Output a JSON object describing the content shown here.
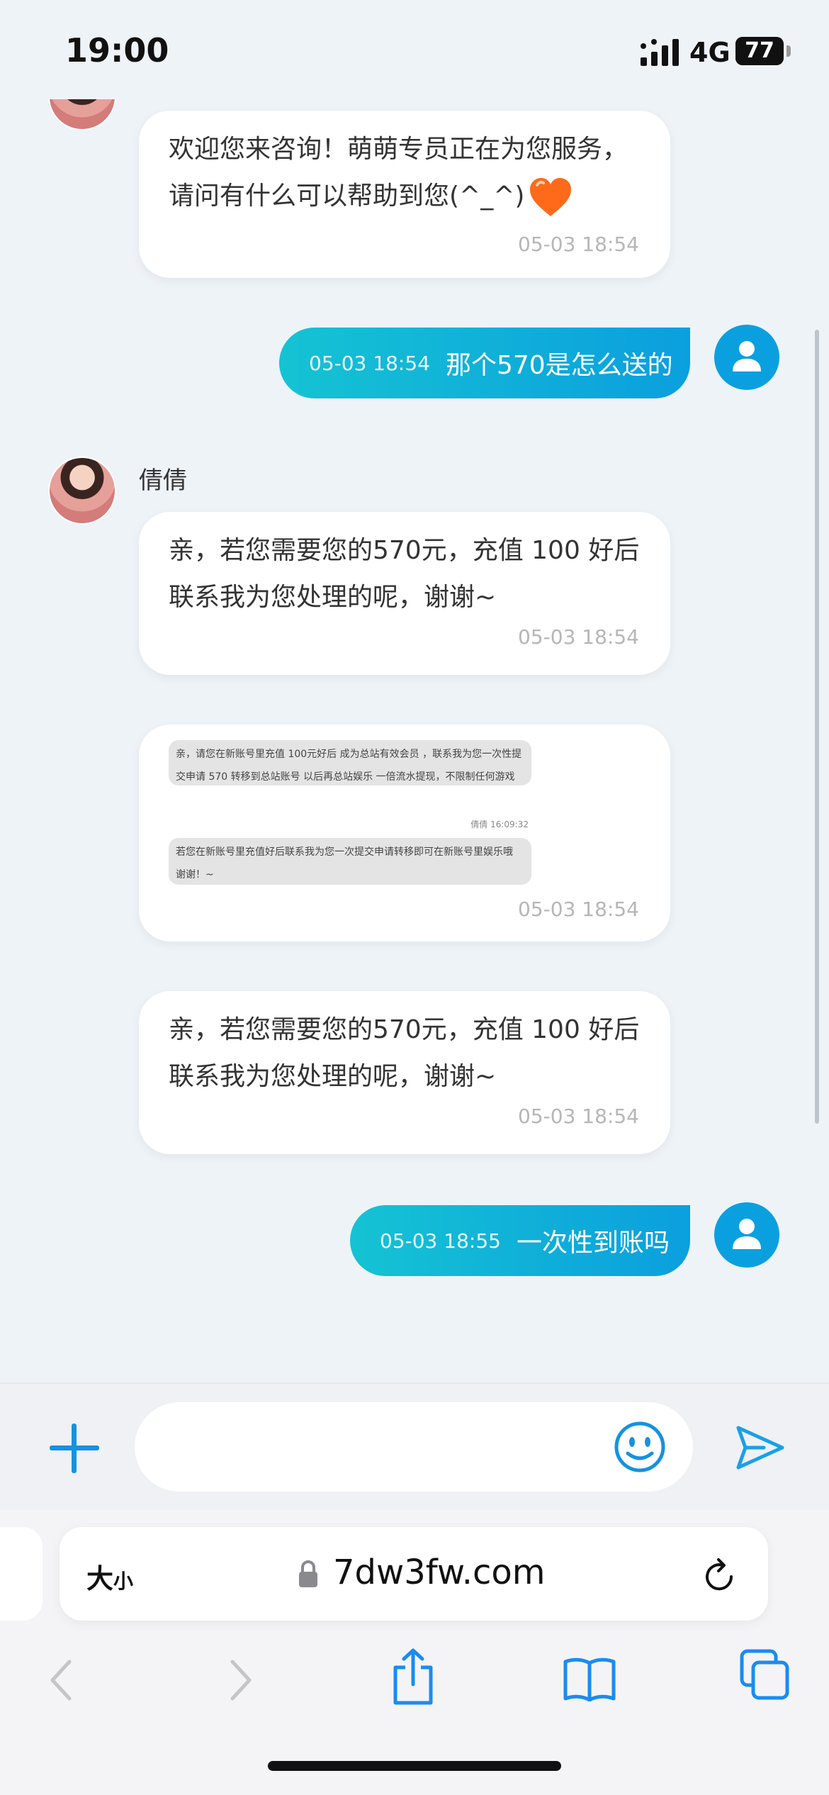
{
  "status_bar": {
    "time": "19:00",
    "network": "4G",
    "battery": "77",
    "battery_level": 0.77
  },
  "chat": {
    "messages": [
      {
        "side": "left",
        "text": "欢迎您来咨询！萌萌专员正在为您服务，请问有什么可以帮助到您(^_^)",
        "time": "05-03 18:54"
      },
      {
        "side": "right",
        "text": "那个570是怎么送的",
        "time": "05-03 18:54"
      },
      {
        "side": "left",
        "sender": "倩倩",
        "text": "亲，若您需要您的570元，充值 100 好后联系我为您处理的呢，谢谢~",
        "time": "05-03 18:54"
      },
      {
        "side": "left",
        "type": "image",
        "time": "05-03 18:54",
        "image": {
          "block1": "亲，请您在新账号里充值 100元好后 成为总站有效会员 ，联系我为您一次性提交申请 570 转移到总站账号 以后再总站娱乐 一倍流水提现，不限制任何游戏",
          "meta": "倩倩 16:09:32",
          "block2": "若您在新账号里充值好后联系我为您一次提交申请转移即可在新账号里娱乐哦 谢谢！~"
        }
      },
      {
        "side": "left",
        "text": "亲，若您需要您的570元，充值 100 好后联系我为您处理的呢，谢谢~",
        "time": "05-03 18:54"
      },
      {
        "side": "right",
        "text": "一次性到账吗",
        "time": "05-03 18:55"
      }
    ]
  },
  "input": {
    "placeholder": "",
    "value": ""
  },
  "browser": {
    "text_size_label": "大",
    "text_size_small": "小",
    "url": "7dw3fw.com"
  },
  "colors": {
    "accent": "#0b9fde",
    "bubble_gradient_start": "#15c3d3",
    "time_gray": "#b6b6b6"
  }
}
